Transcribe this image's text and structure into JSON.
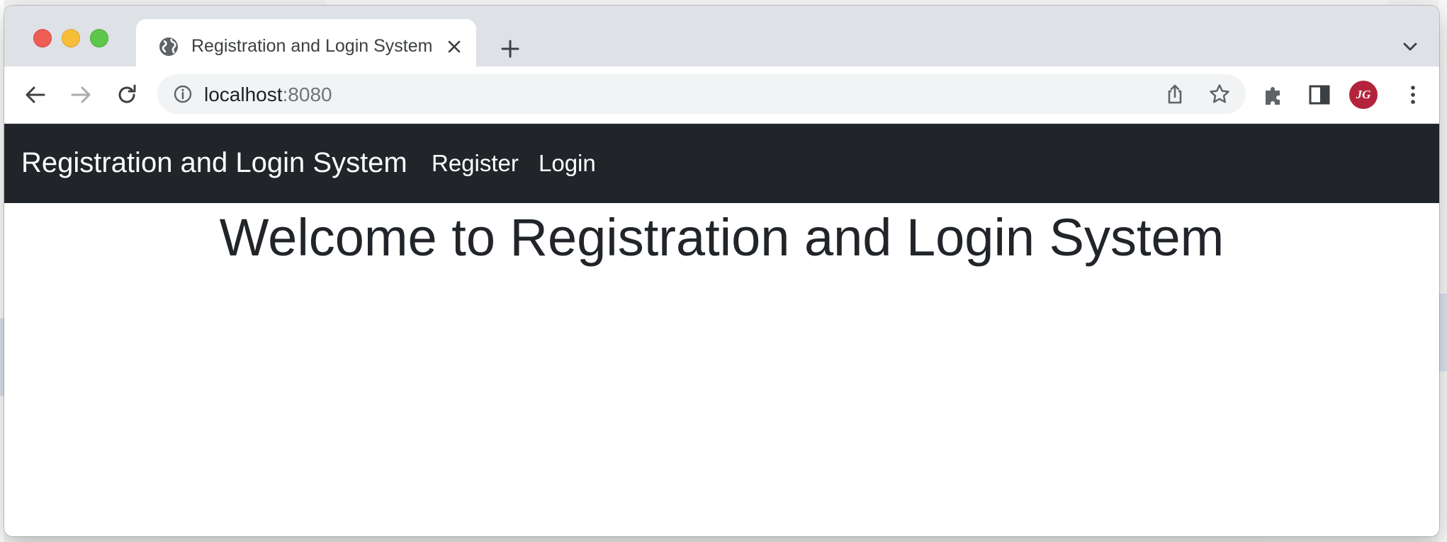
{
  "browser": {
    "tab": {
      "title": "Registration and Login System",
      "favicon": "globe-icon"
    },
    "address_bar": {
      "host": "localhost",
      "port": ":8080"
    },
    "profile_initials": "JG",
    "icons": [
      "back-arrow-icon",
      "forward-arrow-icon",
      "reload-icon",
      "info-icon",
      "share-icon",
      "star-icon",
      "extensions-puzzle-icon",
      "side-panel-icon",
      "kebab-menu-icon",
      "close-icon",
      "plus-icon",
      "chevron-down-icon"
    ]
  },
  "navbar": {
    "brand": "Registration and Login System",
    "links": [
      {
        "label": "Register"
      },
      {
        "label": "Login"
      }
    ],
    "background": "#212529"
  },
  "main": {
    "heading": "Welcome to Registration and Login System"
  }
}
